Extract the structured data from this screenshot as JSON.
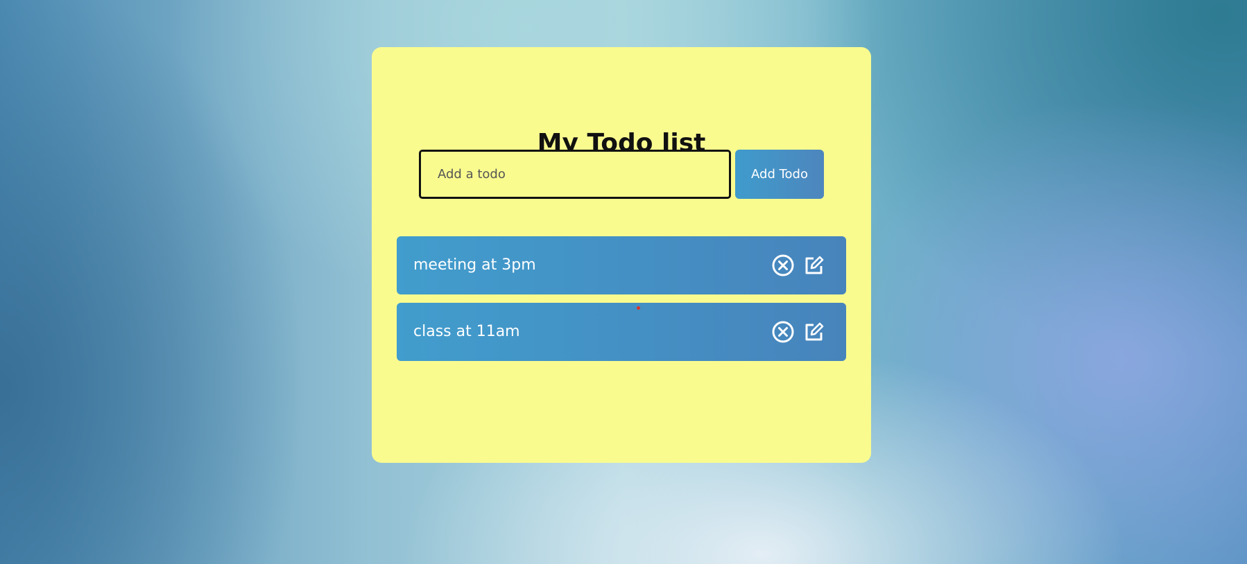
{
  "app": {
    "title": "My Todo list"
  },
  "form": {
    "input_placeholder": "Add a todo",
    "input_value": "",
    "add_button_label": "Add Todo"
  },
  "todos": [
    {
      "text": "meeting at 3pm",
      "delete_icon": "x-circle-icon",
      "edit_icon": "edit-icon"
    },
    {
      "text": "class at 11am",
      "delete_icon": "x-circle-icon",
      "edit_icon": "edit-icon"
    }
  ],
  "colors": {
    "card_background": "#f9fb8f",
    "accent_gradient_start": "#419dcd",
    "accent_gradient_end": "#4784bc",
    "title_text": "#111111",
    "item_text": "#ffffff"
  }
}
